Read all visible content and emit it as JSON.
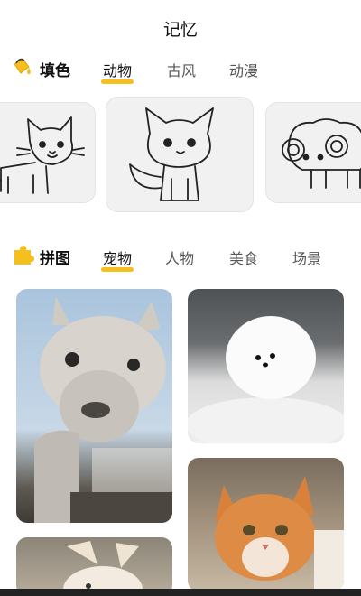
{
  "page_title": "记忆",
  "coloring": {
    "title": "填色",
    "icon": "paint-bucket-icon",
    "tabs": [
      {
        "label": "动物",
        "active": true
      },
      {
        "label": "古风",
        "active": false
      },
      {
        "label": "动漫",
        "active": false
      }
    ],
    "cards": [
      {
        "name": "cat-line-drawing",
        "icon": "cat-outline-icon"
      },
      {
        "name": "fox-line-drawing",
        "icon": "fox-outline-icon"
      },
      {
        "name": "sheep-line-drawing",
        "icon": "sheep-outline-icon"
      }
    ]
  },
  "puzzle": {
    "title": "拼图",
    "icon": "puzzle-piece-icon",
    "tabs": [
      {
        "label": "宠物",
        "active": true
      },
      {
        "label": "人物",
        "active": false
      },
      {
        "label": "美食",
        "active": false
      },
      {
        "label": "场景",
        "active": false
      }
    ],
    "photos": [
      "alpaca-photo",
      "white-puppy-photo",
      "orange-cat-photo",
      "rabbit-photo"
    ]
  },
  "colors": {
    "accent": "#f5bf1e",
    "card_bg": "#f1f1f1"
  }
}
